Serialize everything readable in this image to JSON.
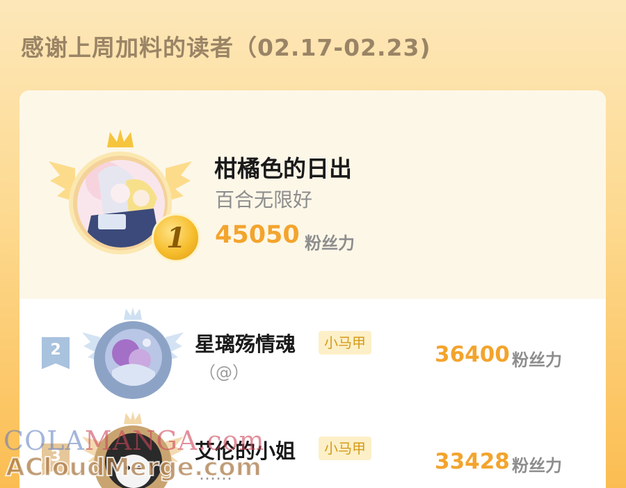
{
  "header": {
    "title": "感谢上周加料的读者（02.17-02.23)"
  },
  "ranking": {
    "first": {
      "rank": "1",
      "name": "柑橘色的日出",
      "subtitle": "百合无限好",
      "score": "45050",
      "score_unit": "粉丝力"
    },
    "rows": [
      {
        "rank": "2",
        "name": "星璃殇情魂",
        "tag": "小马甲",
        "subtitle": "（@）",
        "score": "36400",
        "score_unit": "粉丝力"
      },
      {
        "rank": "3",
        "name": "艾伦的小姐",
        "tag": "小马甲",
        "subtitle": "……",
        "score": "33428",
        "score_unit": "粉丝力"
      }
    ]
  },
  "watermark": {
    "line1_a": "COLA",
    "line1_b": "MANGA",
    "line1_c": ".com",
    "line2": "ACloudMerge.com"
  },
  "colors": {
    "accent": "#f3a42d",
    "title": "#9a8466",
    "tag_bg": "#fdf0c8",
    "tag_text": "#d59a1a"
  },
  "icons": [
    "crown-icon",
    "wing-icon",
    "rank-flag-icon"
  ]
}
